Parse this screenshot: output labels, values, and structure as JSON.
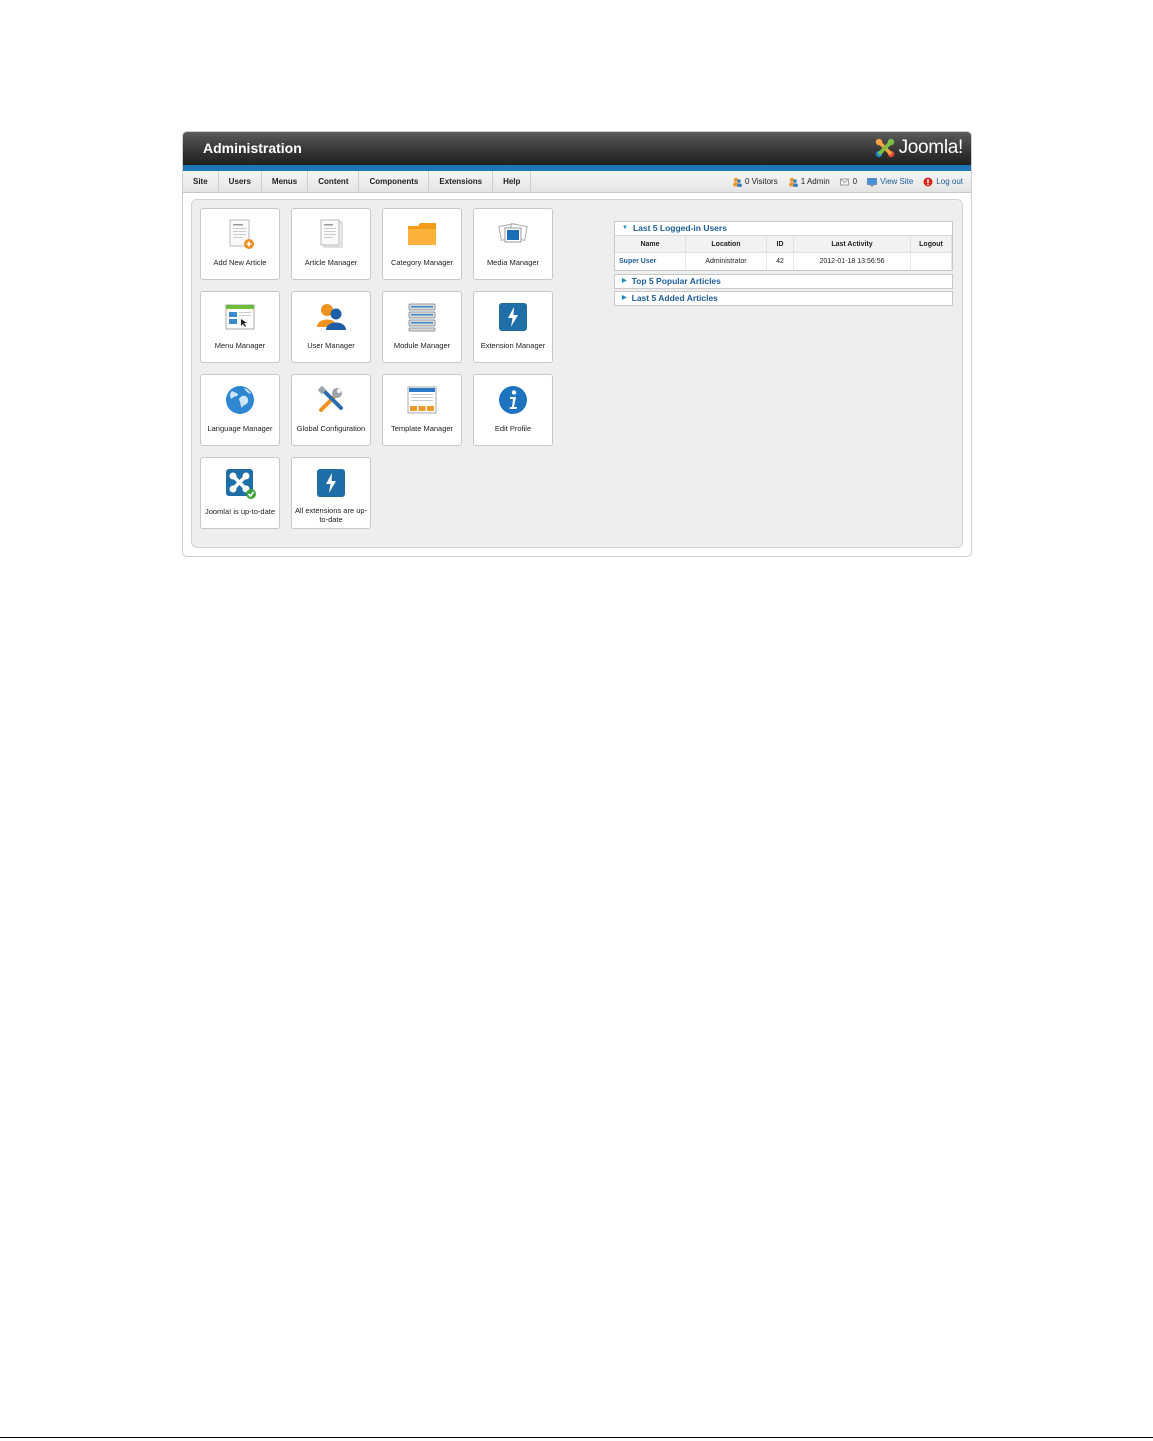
{
  "header": {
    "title": "Administration",
    "logo_text": "Joomla!"
  },
  "menu": [
    "Site",
    "Users",
    "Menus",
    "Content",
    "Components",
    "Extensions",
    "Help"
  ],
  "status": {
    "visitors": "0 Visitors",
    "admins": "1 Admin",
    "messages": "0",
    "view_site": "View Site",
    "logout": "Log out"
  },
  "icons": [
    {
      "label": "Add New Article",
      "icon": "add-article-icon"
    },
    {
      "label": "Article Manager",
      "icon": "article-manager-icon"
    },
    {
      "label": "Category Manager",
      "icon": "folder-icon"
    },
    {
      "label": "Media Manager",
      "icon": "media-icon"
    },
    {
      "label": "Menu Manager",
      "icon": "menu-manager-icon"
    },
    {
      "label": "User Manager",
      "icon": "users-icon"
    },
    {
      "label": "Module Manager",
      "icon": "module-icon"
    },
    {
      "label": "Extension Manager",
      "icon": "extension-icon"
    },
    {
      "label": "Language Manager",
      "icon": "globe-icon"
    },
    {
      "label": "Global Configuration",
      "icon": "tools-icon"
    },
    {
      "label": "Template Manager",
      "icon": "template-icon"
    },
    {
      "label": "Edit Profile",
      "icon": "info-icon"
    },
    {
      "label": "Joomla! is up-to-date",
      "icon": "joomla-check-icon"
    },
    {
      "label": "All extensions are up-to-date",
      "icon": "extension-uptodate-icon"
    }
  ],
  "panels": {
    "logged_in": {
      "title": "Last 5 Logged-in Users",
      "columns": [
        "Name",
        "Location",
        "ID",
        "Last Activity",
        "Logout"
      ],
      "rows": [
        {
          "name": "Super User",
          "location": "Administrator",
          "id": "42",
          "last_activity": "2012-01-18 13:56:56",
          "logout": ""
        }
      ]
    },
    "popular": {
      "title": "Top 5 Popular Articles"
    },
    "added": {
      "title": "Last 5 Added Articles"
    }
  },
  "colors": {
    "accent": "#1e75b8",
    "link": "#1b5e9a",
    "header_dark": "#2a2a2a"
  }
}
